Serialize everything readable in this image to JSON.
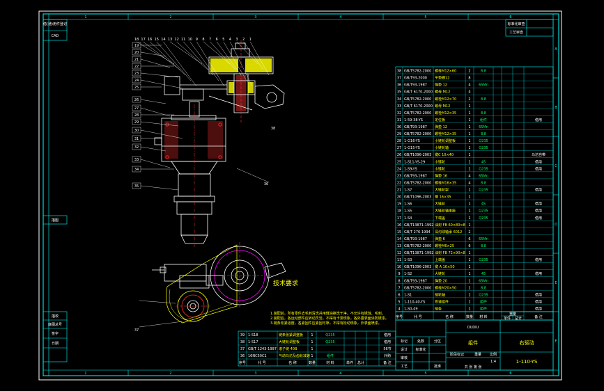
{
  "colors": {
    "background": "#000000",
    "frame": "#ffffff",
    "border": "#00ffff",
    "geometry": "#ffffff",
    "leader": "#ff3030",
    "hatch": "#ffff00",
    "text_yellow": "#ffff00",
    "text_green": "#00ff66"
  },
  "grid": {
    "top": [
      "1",
      "2",
      "3",
      "4",
      "5",
      "6"
    ],
    "bottom": [
      "1",
      "2",
      "3",
      "4",
      "5",
      "6"
    ],
    "right": [
      "A",
      "B",
      "C",
      "D",
      "E",
      "F"
    ]
  },
  "left_strip": [
    "借(通)用件登记",
    "CAD",
    "描图",
    "描校",
    "底图总号",
    "签字",
    "日期"
  ],
  "top_right_labels": [
    "标准化审查",
    "工艺审查"
  ],
  "callouts_top": [
    "18",
    "17",
    "16",
    "15",
    "14",
    "13",
    "12",
    "11",
    "10",
    "9",
    "8",
    "7",
    "6",
    "5",
    "4",
    "3",
    "2",
    "1"
  ],
  "callouts_left": [
    "19",
    "20",
    "21",
    "22",
    "23",
    "24",
    "25",
    "26",
    "27",
    "28",
    "29",
    "30",
    "31",
    "32",
    "33",
    "34",
    "35"
  ],
  "callouts_bottom": [
    "36",
    "37",
    "38"
  ],
  "bom_rows": [
    {
      "no": "38",
      "code": "GB/T5782-2000",
      "name": "螺栓M12×60",
      "qty": "2",
      "mat": "8.8",
      "note": ""
    },
    {
      "no": "37",
      "code": "GB/T93-2000",
      "name": "平垫圈12",
      "qty": "8",
      "mat": "",
      "note": ""
    },
    {
      "no": "36",
      "code": "GB/T93-1987",
      "name": "弹垫 12",
      "qty": "4",
      "mat": "65Mn",
      "note": ""
    },
    {
      "no": "35",
      "code": "GB/T 6170-2000",
      "name": "螺母 M12",
      "qty": "4",
      "mat": "",
      "note": ""
    },
    {
      "no": "34",
      "code": "GB/T5782-2000",
      "name": "螺栓M12×70",
      "qty": "2",
      "mat": "8.8",
      "note": ""
    },
    {
      "no": "33",
      "code": "GB/T 6170-2000",
      "name": "螺母 M12",
      "qty": "1",
      "mat": "",
      "note": ""
    },
    {
      "no": "32",
      "code": "GB/T5782-2000",
      "name": "螺栓M12×35",
      "qty": "1",
      "mat": "8.8",
      "note": ""
    },
    {
      "no": "31",
      "code": "1-59-38-YS",
      "name": "定位板",
      "qty": "1",
      "mat": "组件",
      "note": "借用"
    },
    {
      "no": "30",
      "code": "GB/T93-1987",
      "name": "弹垫 12",
      "qty": "1",
      "mat": "65Mn",
      "note": ""
    },
    {
      "no": "29",
      "code": "GB/T5782-2000",
      "name": "螺栓M12×35",
      "qty": "1",
      "mat": "8.8",
      "note": ""
    },
    {
      "no": "28",
      "code": "1-G16-YS",
      "name": "小链轮调整板",
      "qty": "1",
      "mat": "Q235",
      "note": ""
    },
    {
      "no": "27",
      "code": "1-G15-YS",
      "name": "小链轮轴",
      "qty": "1",
      "mat": "Q235",
      "note": ""
    },
    {
      "no": "26",
      "code": "GB/T1096-2003",
      "name": "键C 10×40",
      "qty": "1",
      "mat": "",
      "note": "马达自带"
    },
    {
      "no": "25",
      "code": "1-S11-YS-29",
      "name": "小链轮",
      "qty": "1",
      "mat": "45",
      "note": "借用"
    },
    {
      "no": "24",
      "code": "1-S9-YS",
      "name": "小链轮",
      "qty": "1",
      "mat": "Q235",
      "note": "借用"
    },
    {
      "no": "23",
      "code": "GB/T93-1987",
      "name": "弹垫 16",
      "qty": "4",
      "mat": "65Mn",
      "note": ""
    },
    {
      "no": "22",
      "code": "GB/T5782-2000",
      "name": "螺栓M16×35",
      "qty": "4",
      "mat": "8.8",
      "note": ""
    },
    {
      "no": "21",
      "code": "1-S7",
      "name": "大链轮架",
      "qty": "1",
      "mat": "Q235",
      "note": "借用"
    },
    {
      "no": "20",
      "code": "GB/T1096-2003",
      "name": "键 16×35",
      "qty": "1",
      "mat": "",
      "note": ""
    },
    {
      "no": "19",
      "code": "1-S6",
      "name": "大链轮",
      "qty": "1",
      "mat": "45",
      "note": "借用"
    },
    {
      "no": "18",
      "code": "1-S5",
      "name": "大链轮轴承座",
      "qty": "1",
      "mat": "Q235",
      "note": "借用"
    },
    {
      "no": "17",
      "code": "1-S4",
      "name": "下端盖",
      "qty": "1",
      "mat": "Q235",
      "note": "借用"
    },
    {
      "no": "16",
      "code": "GB/T13871-1992",
      "name": "油封 FB 60×80×8",
      "qty": "1",
      "mat": "",
      "note": ""
    },
    {
      "no": "15",
      "code": "GB/T 276-1994",
      "name": "深沟球轴承 6012",
      "qty": "2",
      "mat": "",
      "note": ""
    },
    {
      "no": "14",
      "code": "GB/T93-1987",
      "name": "弹垫 6",
      "qty": "6",
      "mat": "65Mn",
      "note": ""
    },
    {
      "no": "13",
      "code": "GB/T5782-2000",
      "name": "螺栓M6×25",
      "qty": "6",
      "mat": "8.8",
      "note": ""
    },
    {
      "no": "12",
      "code": "GB/T13871-1992",
      "name": "油封 FB 72×90×8",
      "qty": "1",
      "mat": "",
      "note": ""
    },
    {
      "no": "11",
      "code": "1-S3",
      "name": "上端盖",
      "qty": "1",
      "mat": "Q235",
      "note": "借用"
    },
    {
      "no": "10",
      "code": "GB/T1096-2003",
      "name": "键 A 16×50",
      "qty": "1",
      "mat": "",
      "note": ""
    },
    {
      "no": "9",
      "code": "1-S2",
      "name": "大链轮",
      "qty": "1",
      "mat": "45",
      "note": "借用"
    },
    {
      "no": "8",
      "code": "GB/T93-1987",
      "name": "弹垫 20",
      "qty": "1",
      "mat": "65Mn",
      "note": ""
    },
    {
      "no": "7",
      "code": "GB/T5782-2000",
      "name": "螺栓M20×50",
      "qty": "1",
      "mat": "8.8",
      "note": ""
    },
    {
      "no": "6",
      "code": "1-S1",
      "name": "链轮轴",
      "qty": "1",
      "mat": "Q235",
      "note": "借用"
    },
    {
      "no": "5",
      "code": "1-110-40-YS",
      "name": "变速组件",
      "qty": "1",
      "mat": "组件",
      "note": "借用"
    },
    {
      "no": "4",
      "code": "1-S0-49",
      "name": "链条",
      "qty": "1",
      "mat": "组件",
      "note": "借用"
    }
  ],
  "bom_header": {
    "no": "序号",
    "code": "代  号",
    "name": "名  称",
    "qty": "数量",
    "mat": "材  料",
    "unit_weight": "单件",
    "total_weight": "总计",
    "weight_group": "重量",
    "note": "备  注"
  },
  "bottom_rows": [
    {
      "no": "39",
      "code": "1-S18",
      "name": "链条张紧调整板",
      "qty": "1",
      "mat": "Q235",
      "note": "借用"
    },
    {
      "no": "38",
      "code": "1-S17",
      "name": "大链轮调整板",
      "qty": "1",
      "mat": "Q235",
      "note": "借用"
    },
    {
      "no": "37",
      "code": "GB/T 1243-1997",
      "name": "滚子链 40B",
      "qty": "1",
      "mat": "",
      "note": "56节"
    },
    {
      "no": "36",
      "code": "16NC50C1",
      "name": "气动马达及齿轮减速",
      "qty": "1",
      "mat": "组件",
      "note": "外购"
    }
  ],
  "tech_title": "技术要求",
  "tech_lines": [
    "1.装配前，所有零件去毛刺清洗并用煤油擦洗干净，不允许有锈蚀、毛刺。",
    "2.装配后，各运动部件应转动灵活，不得有卡滞现象，各外露表面涂防锈漆。",
    "3.链条松紧适度，各紧固件应紧固可靠，不得有松动现象，外表面喷漆。"
  ],
  "title_block": {
    "company": "DUDIU",
    "part_name": "组件",
    "drawing_name": "右驱动",
    "drawing_no": "1-110-YS",
    "rev_labels": [
      "标记",
      "处数",
      "分区",
      "更改文件号",
      "签名",
      "年月日"
    ],
    "role_labels": [
      "设计",
      "审核",
      "工艺",
      "批准"
    ],
    "std_label": "标准化",
    "stage_labels": [
      "阶段标记",
      "重量",
      "比例"
    ],
    "scale": "1:4",
    "sheet": "共  张   第  张"
  }
}
